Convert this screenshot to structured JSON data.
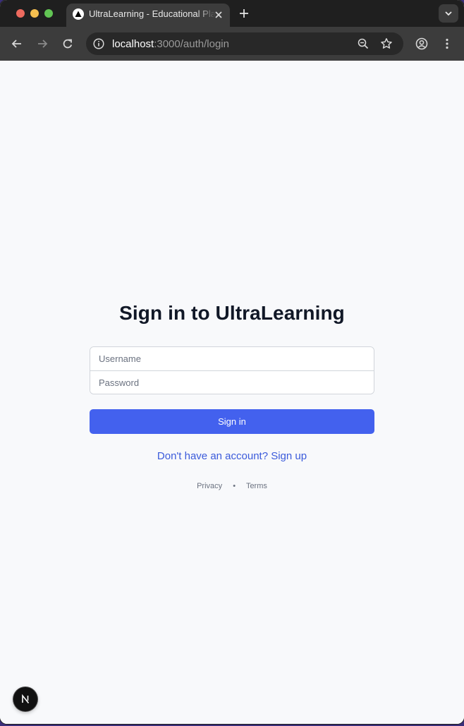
{
  "browser": {
    "tab": {
      "title": "UltraLearning - Educational Platform",
      "favicon": "triangle-icon"
    },
    "url": {
      "host": "localhost",
      "path": ":3000/auth/login"
    },
    "icons": {
      "back": "back-arrow-icon",
      "forward": "forward-arrow-icon",
      "reload": "reload-icon",
      "site_info": "info-icon",
      "zoom": "zoom-out-icon",
      "bookmark": "star-icon",
      "profile": "profile-icon",
      "menu": "kebab-menu-icon",
      "new_tab": "plus-icon",
      "tab_search": "chevron-down-icon"
    }
  },
  "login": {
    "title": "Sign in to UltraLearning",
    "username_placeholder": "Username",
    "username_value": "",
    "password_placeholder": "Password",
    "password_value": "",
    "submit_label": "Sign in",
    "signup_link": "Don't have an account? Sign up",
    "footer": {
      "privacy": "Privacy",
      "separator": "•",
      "terms": "Terms"
    }
  },
  "dev_badge": {
    "label": "N",
    "icon": "nextjs-icon"
  },
  "colors": {
    "primary": "#4361ee",
    "link": "#3b5bdb",
    "page_background": "#f8f9fb",
    "title": "#111827"
  }
}
